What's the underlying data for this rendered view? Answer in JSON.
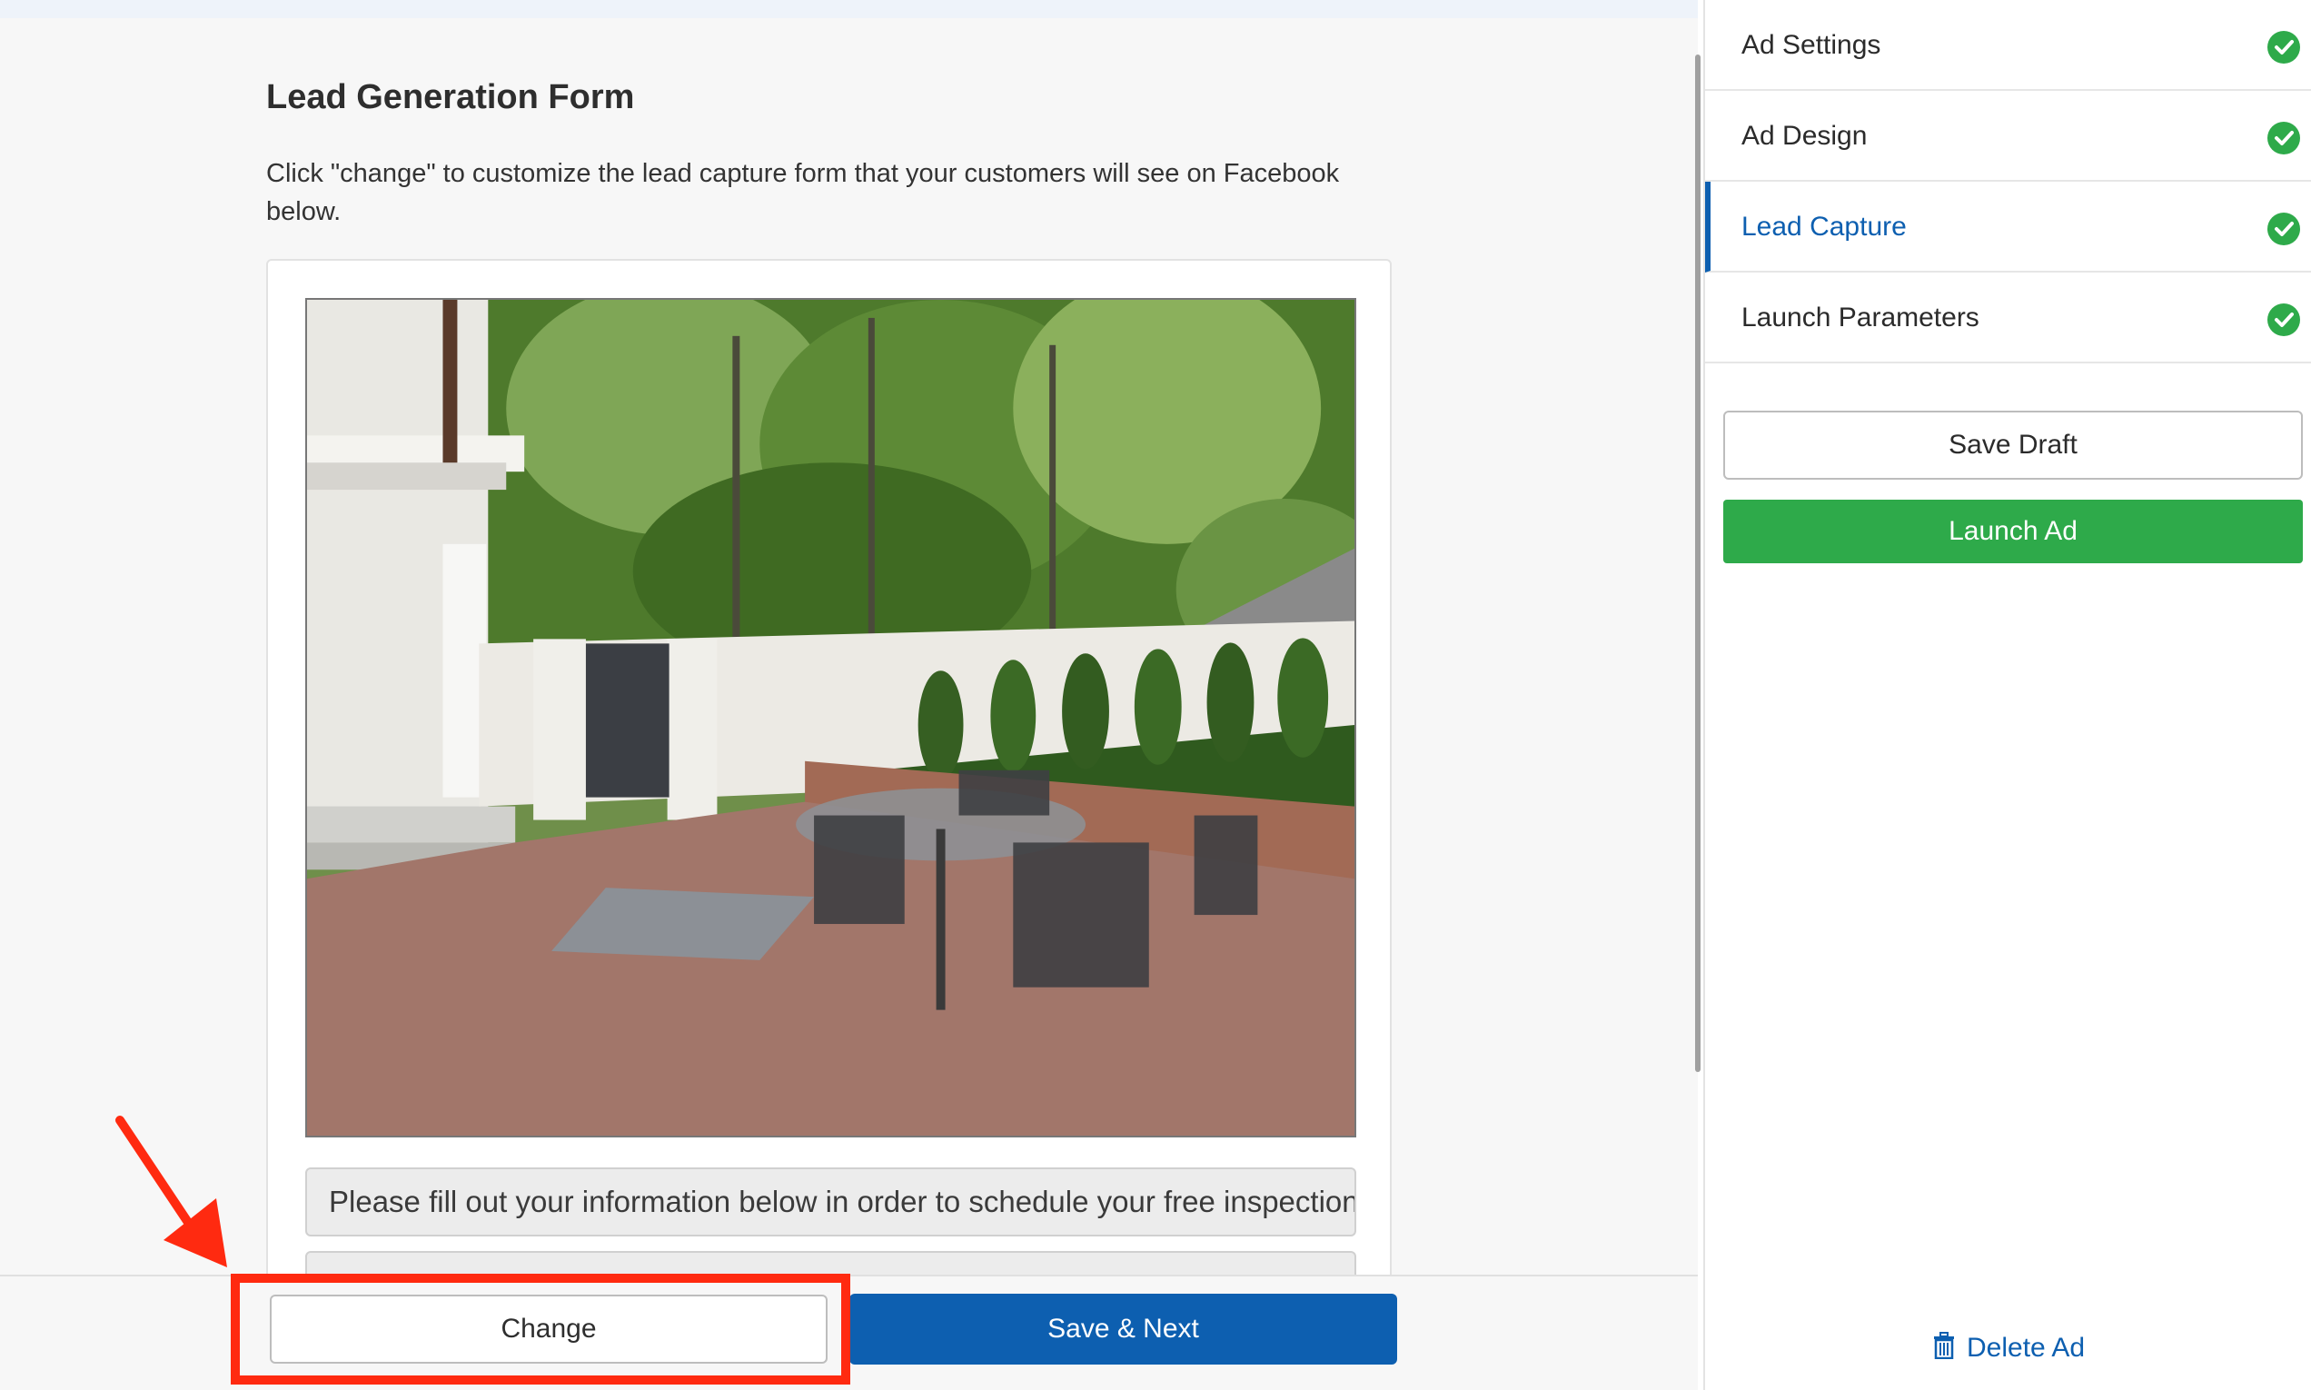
{
  "main": {
    "title": "Lead Generation Form",
    "description": "Click \"change\" to customize the lead capture form that your customers will see on Facebook below.",
    "info_text": "Please fill out your information below in order to schedule your free inspection",
    "change_label": "Change",
    "save_next_label": "Save & Next"
  },
  "sidebar": {
    "steps": [
      {
        "label": "Ad Settings",
        "complete": true
      },
      {
        "label": "Ad Design",
        "complete": true
      },
      {
        "label": "Lead Capture",
        "complete": true,
        "active": true
      },
      {
        "label": "Launch Parameters",
        "complete": true
      }
    ],
    "save_draft_label": "Save Draft",
    "launch_label": "Launch Ad",
    "delete_label": "Delete Ad"
  },
  "colors": {
    "primary_blue": "#0d5fb0",
    "success_green": "#2eaa4a",
    "highlight_red": "#ff2a10"
  },
  "icons": [
    "check-circle-icon",
    "trash-icon",
    "arrow-annotation"
  ]
}
